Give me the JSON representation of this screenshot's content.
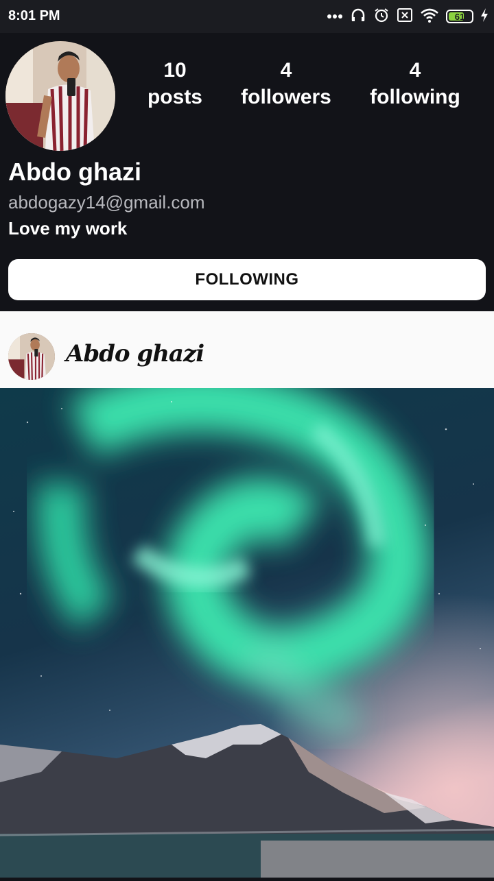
{
  "status_bar": {
    "time": "8:01 PM",
    "battery_level": "61",
    "icons": [
      "more-dots-icon",
      "headphones-icon",
      "alarm-icon",
      "sim-off-icon",
      "wifi-icon",
      "battery-icon",
      "charging-bolt-icon"
    ]
  },
  "profile": {
    "stats": [
      {
        "value": "10",
        "label": "posts"
      },
      {
        "value": "4",
        "label": "followers"
      },
      {
        "value": "4",
        "label": "following"
      }
    ],
    "name": "Abdo ghazi",
    "email": "abdogazy14@gmail.com",
    "bio": "Love my work",
    "follow_button_label": "FOLLOWING"
  },
  "post": {
    "username": "Abdo ghazi"
  },
  "colors": {
    "background": "#121318",
    "status_bar": "#1b1c21",
    "battery_fill": "#8bd23f",
    "post_header_bg": "#fafafa",
    "aurora": "#3de8b0"
  }
}
